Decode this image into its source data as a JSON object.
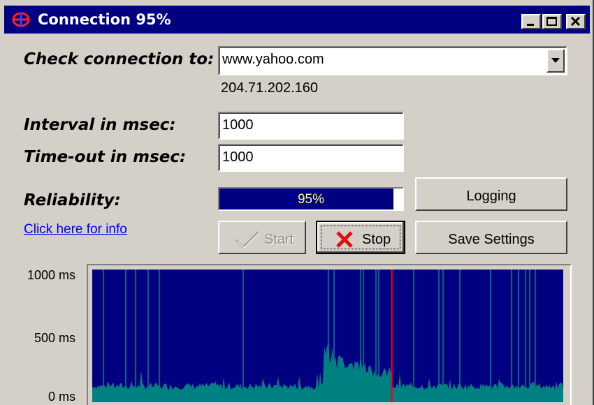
{
  "window": {
    "title": "Connection 95%"
  },
  "form": {
    "check_label": "Check connection to:",
    "host_value": "www.yahoo.com",
    "ip_address": "204.71.202.160",
    "interval_label": "Interval in msec:",
    "interval_value": "1000",
    "timeout_label": "Time-out in msec:",
    "timeout_value": "1000",
    "reliability_label": "Reliability:",
    "reliability_percent": 95,
    "reliability_text": "95%",
    "info_link": "Click here for info"
  },
  "buttons": {
    "logging": "Logging",
    "start": "Start",
    "stop": "Stop",
    "save": "Save Settings"
  },
  "graph": {
    "y_labels": [
      "1000 ms",
      "500 ms",
      "0 ms"
    ],
    "background_color": "#000080",
    "response_color": "#008080",
    "marker_color": "#ff0000",
    "marker_fraction": 0.636
  },
  "colors": {
    "title_bar": "#000080",
    "face": "#d4d0c8",
    "progress": "#000080",
    "link": "#0000ee"
  }
}
